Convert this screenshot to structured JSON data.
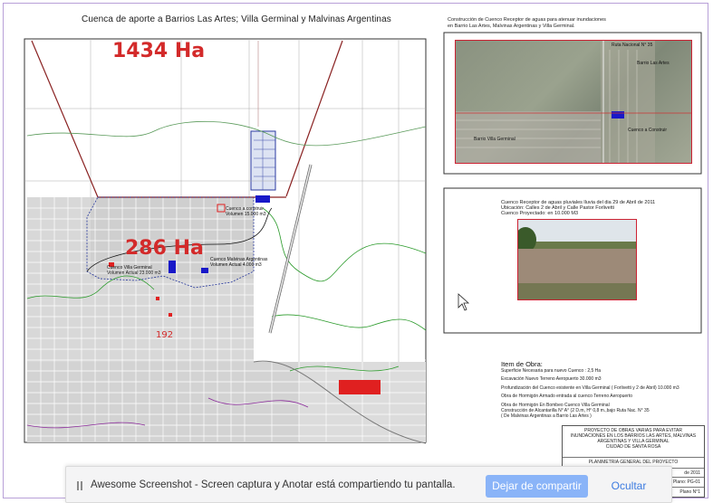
{
  "map": {
    "title": "Cuenca de aporte  a Barrios Las Artes; Villa Germinal y Malvinas Argentinas",
    "area_outer": "1434 Ha",
    "area_inner": "286 Ha",
    "route_label": "192",
    "notes": [
      "Cuenco a construir",
      "Volumen  15.000 m3",
      "Cuenco Villa Germinal",
      "Volumen Actual 23.000 m3",
      "Cuenco Malvinas Argentinas",
      "Volumen Actual 4.000 m3"
    ],
    "colors": {
      "basin_outline": "#8a2222",
      "retention": "#1818c8",
      "label_red": "#d32a2a",
      "contour_green": "#2a9a2a",
      "contour_purple": "#8a2a9a"
    }
  },
  "satellite": {
    "caption_line1": "Construcción de Cuenco Receptor de aguas  para atenuar inundaciones",
    "caption_line2": "en Barrio Las Artes, Malvinas Argentinas y Villa Germinal.",
    "labels": [
      "Ruta Nacional N° 35",
      "Barrio Las Artes",
      "Barrio Villa Germinal",
      "Cuenco a Construir"
    ]
  },
  "photo_panel": {
    "line1": "Cuenco Receptor de aguas  pluviales  lluvia del dia 29 de Abril de 2011",
    "line2": "Ubicación: Calles 2 de Abril y Calle Pastor Forlivetti",
    "line3": "Cuenco  Proyectado:    en  10.000 M3"
  },
  "items": {
    "heading": "Item de Obra:",
    "lines": [
      "Superficie Necesaria para nuevo Cuenco :  2,5 Ha",
      "Excavación Nuevo Terreno  Aeropuerto  30.000  m3",
      "Profundización del Cuenco existente en Villa Germinal ( Forlivetti y 2 de Abril)  10.000 m3",
      "Obra de Hormigón Armado entrada al cuenco Terreno Aeropuerto",
      "Obra de Hormigón En Bombeo Cuenco Villa Germinal",
      "Construcción de Alcantarilla N° A° (2 D.m, H° 0,8 m.,bajo Ruta Nac. N° 35",
      "( De Malvinas Argentinas a Barrio Las Artes )"
    ]
  },
  "title_block": {
    "project_lines": [
      "PROYECTO DE OBRAS VARIAS PARA EVITAR",
      "INUNDACIONES EN LOS BARRIOS LAS ARTES, MALVINAS",
      "ARGENTINAS Y VILLA GERMINAL",
      "CIUDAD DE SANTA ROSA"
    ],
    "sheet_name": "PLANIMETRIA GENERAL DEL PROYECTO",
    "date": "de 2011",
    "plan_code": "Plano: PG-01",
    "plan_number": "Plano N°1"
  },
  "share_bar": {
    "message": "Awesome Screenshot - Screen captura y Anotar  está compartiendo tu pantalla.",
    "stop_label": "Dejar de compartir",
    "hide_label": "Ocultar"
  }
}
